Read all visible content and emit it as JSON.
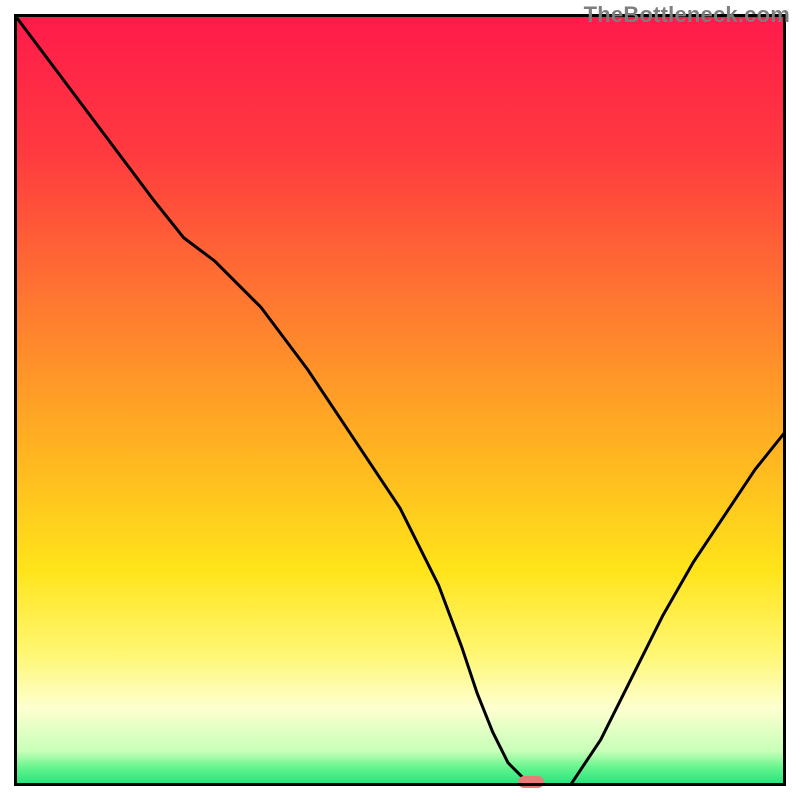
{
  "watermark": "TheBottleneck.com",
  "colors": {
    "frame": "#000000",
    "watermark_text": "#7e7e7e",
    "gradient_stops": [
      {
        "offset": 0.0,
        "color": "#ff1a4b"
      },
      {
        "offset": 0.18,
        "color": "#ff3a3f"
      },
      {
        "offset": 0.38,
        "color": "#ff7a30"
      },
      {
        "offset": 0.58,
        "color": "#ffb820"
      },
      {
        "offset": 0.72,
        "color": "#ffe41a"
      },
      {
        "offset": 0.83,
        "color": "#fff774"
      },
      {
        "offset": 0.9,
        "color": "#fdffd0"
      },
      {
        "offset": 0.955,
        "color": "#c7ffb8"
      },
      {
        "offset": 0.975,
        "color": "#6af58f"
      },
      {
        "offset": 1.0,
        "color": "#18e37a"
      }
    ],
    "curve": "#000000",
    "marker": "#e77b78"
  },
  "chart_data": {
    "type": "line",
    "title": "",
    "xlabel": "",
    "ylabel": "",
    "xlim": [
      0,
      100
    ],
    "ylim": [
      0,
      100
    ],
    "grid": false,
    "annotations": [
      {
        "text": "TheBottleneck.com",
        "pos": "top-right"
      }
    ],
    "series": [
      {
        "name": "bottleneck-curve",
        "x": [
          0,
          6,
          12,
          18,
          22,
          26,
          32,
          38,
          44,
          50,
          55,
          58,
          60,
          62,
          64,
          66,
          68,
          72,
          76,
          80,
          84,
          88,
          92,
          96,
          100
        ],
        "y": [
          100,
          92,
          84,
          76,
          71,
          68,
          62,
          54,
          45,
          36,
          26,
          18,
          12,
          7,
          3,
          1,
          0,
          0,
          6,
          14,
          22,
          29,
          35,
          41,
          46
        ]
      }
    ],
    "marker": {
      "x": 67,
      "y": 0.5
    }
  }
}
